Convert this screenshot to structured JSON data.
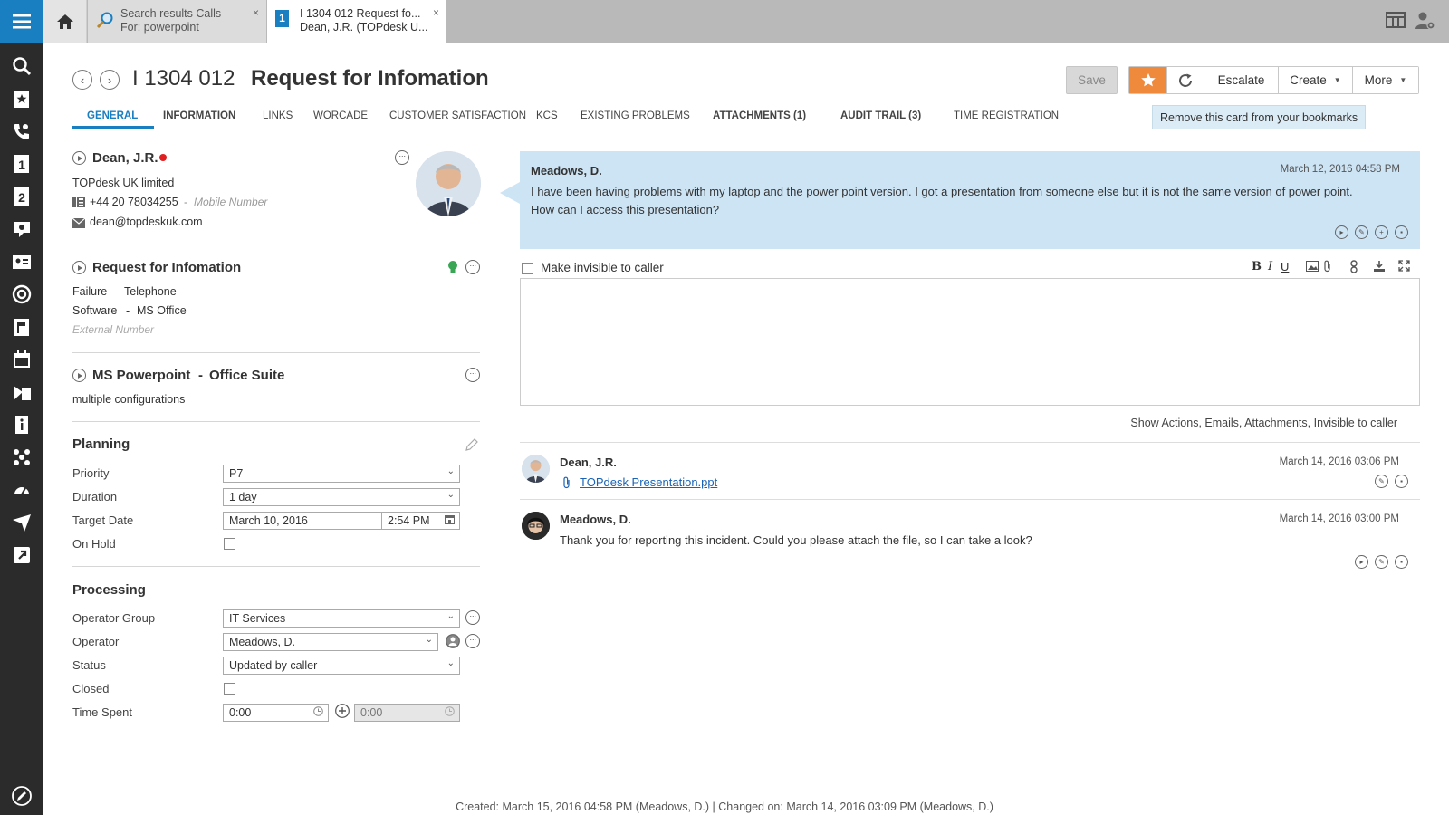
{
  "topbar": {
    "tabs": [
      {
        "line1": "Search results Calls",
        "line2": "For: powerpoint"
      },
      {
        "line1": "I 1304 012 Request fo...",
        "line2": "Dean, J.R. (TOPdesk U..."
      }
    ],
    "incident_tab_badge": "1",
    "close_glyph": "×"
  },
  "header": {
    "number": "I 1304 012",
    "title": "Request for Infomation",
    "save_label": "Save",
    "escalate_label": "Escalate",
    "create_label": "Create",
    "more_label": "More",
    "tooltip": "Remove this card from your bookmarks"
  },
  "tabs": [
    "GENERAL",
    "INFORMATION",
    "LINKS",
    "WORCADE",
    "CUSTOMER SATISFACTION",
    "KCS",
    "EXISTING PROBLEMS",
    "ATTACHMENTS (1)",
    "AUDIT TRAIL (3)",
    "TIME REGISTRATION"
  ],
  "caller": {
    "name": "Dean, J.R.",
    "company": "TOPdesk UK limited",
    "phone": "+44 20 78034255",
    "phone_sep": "-",
    "phone_type": "Mobile Number",
    "email": "dean@topdeskuk.com",
    "status_color": "#e02020"
  },
  "request": {
    "title": "Request for Infomation",
    "category": "Failure",
    "category_sep": "-",
    "entry_type": "Telephone",
    "subcategory": "Software",
    "subcategory_sep": "-",
    "subcategory_value": "MS Office",
    "external_number_placeholder": "External Number"
  },
  "object": {
    "name": "MS Powerpoint",
    "sep": "-",
    "type": "Office Suite",
    "config": "multiple configurations"
  },
  "planning": {
    "title": "Planning",
    "priority_label": "Priority",
    "priority": "P7",
    "duration_label": "Duration",
    "duration": "1 day",
    "target_label": "Target Date",
    "target_date": "March 10, 2016",
    "target_time": "2:54 PM",
    "onhold_label": "On Hold"
  },
  "processing": {
    "title": "Processing",
    "opgroup_label": "Operator Group",
    "opgroup": "IT Services",
    "operator_label": "Operator",
    "operator": "Meadows, D.",
    "status_label": "Status",
    "status": "Updated by caller",
    "closed_label": "Closed",
    "timespent_label": "Time Spent",
    "timespent": "0:00",
    "timespent_total": "0:00"
  },
  "thread": {
    "first": {
      "author": "Meadows, D.",
      "date": "March 12, 2016 04:58 PM",
      "text_line1": "I have been having problems with my laptop and the power point version. I got a presentation from someone else but it is not the same version of power point.",
      "text_line2": "How can I access this presentation?"
    },
    "invisible_label": "Make invisible to caller",
    "show_actions": "Show Actions, Emails, Attachments, Invisible to caller",
    "entries": [
      {
        "author": "Dean, J.R.",
        "date": "March 14, 2016 03:06 PM",
        "attachment": "TOPdesk Presentation.ppt"
      },
      {
        "author": "Meadows, D.",
        "date": "March 14, 2016 03:00 PM",
        "text": "Thank you for reporting this incident. Could you please attach the file, so I can take a look?"
      }
    ]
  },
  "editor_toolbar": {
    "bold": "B",
    "italic": "I",
    "underline": "U"
  },
  "footer": "Created: March 15, 2016 04:58 PM (Meadows, D.) | Changed on: March 14, 2016 03:09 PM (Meadows, D.)",
  "colors": {
    "accent": "#1a7fc1",
    "star": "#ef8a3c",
    "bubble": "#cde4f5",
    "rail": "#2b2b2b"
  }
}
